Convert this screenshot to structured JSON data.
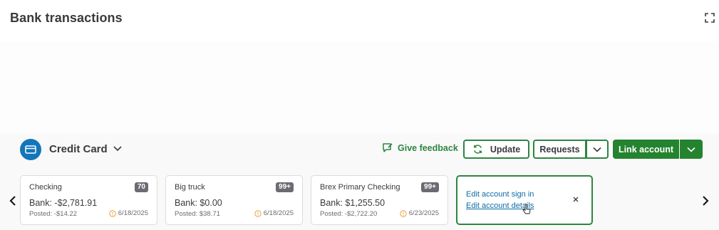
{
  "page": {
    "title": "Bank transactions"
  },
  "account": {
    "name": "Credit Card"
  },
  "actions": {
    "feedback_label": "Give feedback",
    "update_label": "Update",
    "requests_label": "Requests",
    "link_account_label": "Link account"
  },
  "cards": [
    {
      "name": "Checking",
      "badge": "70",
      "bank": "Bank: -$2,781.91",
      "posted": "Posted: -$14.22",
      "date": "6/18/2025"
    },
    {
      "name": "Big truck",
      "badge": "99+",
      "bank": "Bank: $0.00",
      "posted": "Posted: $38.71",
      "date": "6/18/2025"
    },
    {
      "name": "Brex Primary Checking",
      "badge": "99+",
      "bank": "Bank: $1,255.50",
      "posted": "Posted: -$2,722.20",
      "date": "6/23/2025"
    }
  ],
  "popover": {
    "sign_in_label": "Edit account sign in",
    "details_label": "Edit account details",
    "close_label": "×"
  },
  "colors": {
    "brand_green": "#2e8540",
    "link_blue": "#0d6ca8",
    "icon_blue": "#1476b9",
    "warning_orange": "#e8a33d"
  },
  "icons": [
    "expand-icon",
    "credit-card-icon",
    "chevron-down-icon",
    "feedback-icon",
    "refresh-icon",
    "chevron-left-icon",
    "chevron-right-icon",
    "warning-icon",
    "close-icon",
    "pointer-cursor-icon"
  ]
}
